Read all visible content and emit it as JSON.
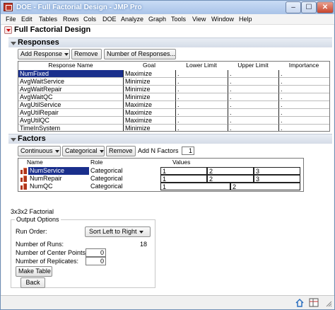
{
  "window": {
    "title": "DOE - Full Factorial Design - JMP Pro",
    "minimize": "–",
    "maximize": "☐",
    "close": "✕"
  },
  "menu": [
    "File",
    "Edit",
    "Tables",
    "Rows",
    "Cols",
    "DOE",
    "Analyze",
    "Graph",
    "Tools",
    "View",
    "Window",
    "Help"
  ],
  "platform_title": "Full Factorial Design",
  "responses": {
    "heading": "Responses",
    "add_response": "Add Response",
    "remove": "Remove",
    "number_of_responses": "Number of Responses...",
    "columns": [
      "Response Name",
      "Goal",
      "Lower Limit",
      "Upper Limit",
      "Importance"
    ],
    "rows": [
      {
        "name": "NumFixed",
        "goal": "Maximize",
        "lower": ".",
        "upper": ".",
        "importance": "."
      },
      {
        "name": "AvgWaitService",
        "goal": "Minimize",
        "lower": ".",
        "upper": ".",
        "importance": "."
      },
      {
        "name": "AvgWaitRepair",
        "goal": "Minimize",
        "lower": ".",
        "upper": ".",
        "importance": "."
      },
      {
        "name": "AvgWaitQC",
        "goal": "Minimize",
        "lower": ".",
        "upper": ".",
        "importance": "."
      },
      {
        "name": "AvgUtilService",
        "goal": "Maximize",
        "lower": ".",
        "upper": ".",
        "importance": "."
      },
      {
        "name": "AvgUtilRepair",
        "goal": "Maximize",
        "lower": ".",
        "upper": ".",
        "importance": "."
      },
      {
        "name": "AvgUtilQC",
        "goal": "Maximize",
        "lower": ".",
        "upper": ".",
        "importance": "."
      },
      {
        "name": "TimeInSystem",
        "goal": "Minimize",
        "lower": ".",
        "upper": ".",
        "importance": "."
      }
    ]
  },
  "factors": {
    "heading": "Factors",
    "continuous": "Continuous",
    "categorical": "Categorical",
    "remove": "Remove",
    "add_n_factors": "Add N Factors",
    "n_factors_value": "1",
    "columns": [
      "Name",
      "Role",
      "Values"
    ],
    "rows": [
      {
        "name": "NumService",
        "role": "Categorical",
        "values": [
          "1",
          "2",
          "3"
        ]
      },
      {
        "name": "NumRepair",
        "role": "Categorical",
        "values": [
          "1",
          "2",
          "3"
        ]
      },
      {
        "name": "NumQC",
        "role": "Categorical",
        "values": [
          "1",
          "2"
        ]
      }
    ]
  },
  "design_label": "3x3x2 Factorial",
  "output": {
    "legend": "Output Options",
    "run_order_label": "Run Order:",
    "run_order_value": "Sort Left to Right",
    "number_of_runs_label": "Number of Runs:",
    "number_of_runs_value": "18",
    "center_points_label": "Number of Center Points:",
    "center_points_value": "0",
    "replicates_label": "Number of Replicates:",
    "replicates_value": "0",
    "make_table": "Make Table",
    "back": "Back"
  },
  "icons": [
    "app-icon",
    "red-triangle-menu-icon",
    "disclosure-icon",
    "factor-categorical-icon",
    "home-icon",
    "table-icon",
    "resize-grip-icon"
  ]
}
